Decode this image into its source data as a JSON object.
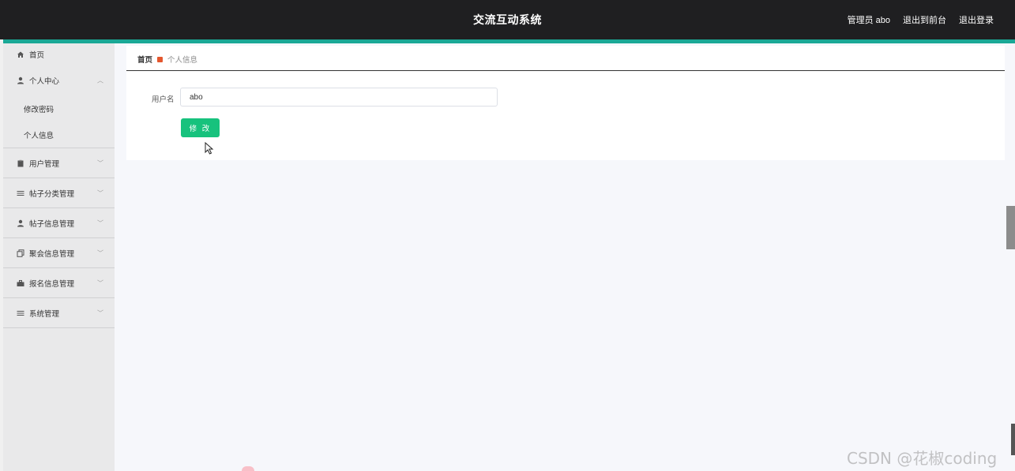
{
  "header": {
    "title": "交流互动系统",
    "user_label": "管理员 abo",
    "to_front_label": "退出到前台",
    "logout_label": "退出登录",
    "accent_color": "#1aa896"
  },
  "sidebar": {
    "items": [
      {
        "label": "首页",
        "icon": "home-icon"
      },
      {
        "label": "个人中心",
        "icon": "user-icon",
        "expanded": true,
        "children": [
          {
            "label": "修改密码"
          },
          {
            "label": "个人信息"
          }
        ]
      },
      {
        "label": "用户管理",
        "icon": "clipboard-icon"
      },
      {
        "label": "帖子分类管理",
        "icon": "list-icon"
      },
      {
        "label": "帖子信息管理",
        "icon": "user-icon"
      },
      {
        "label": "聚会信息管理",
        "icon": "copy-icon"
      },
      {
        "label": "报名信息管理",
        "icon": "briefcase-icon"
      },
      {
        "label": "系统管理",
        "icon": "list-icon"
      }
    ]
  },
  "breadcrumb": {
    "home": "首页",
    "current": "个人信息"
  },
  "form": {
    "username_label": "用户名",
    "username_value": "abo",
    "submit_label": "修 改",
    "submit_color": "#17c27d"
  },
  "watermark": "CSDN @花椒coding"
}
